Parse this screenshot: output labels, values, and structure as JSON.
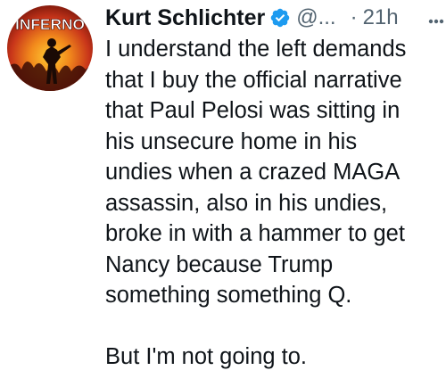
{
  "tweet": {
    "author": {
      "display_name": "Kurt Schlichter",
      "handle": "@...",
      "verified": true,
      "avatar_text": "INFERNO"
    },
    "separator": "·",
    "time": "21h",
    "body_lines": [
      "I understand the left demands",
      "that I buy the official narrative",
      "that Paul Pelosi was sitting in",
      "his unsecure home in his",
      "undies when a crazed MAGA",
      "assassin, also in his undies,",
      "broke in with a hammer to get",
      "Nancy because Trump",
      "something something Q."
    ],
    "body_final": "But I'm not going to.",
    "colors": {
      "text": "#0f1419",
      "secondary": "#536471",
      "verified_badge": "#1d9bf0"
    },
    "icons": [
      "verified-badge-icon",
      "more-options-icon"
    ]
  }
}
